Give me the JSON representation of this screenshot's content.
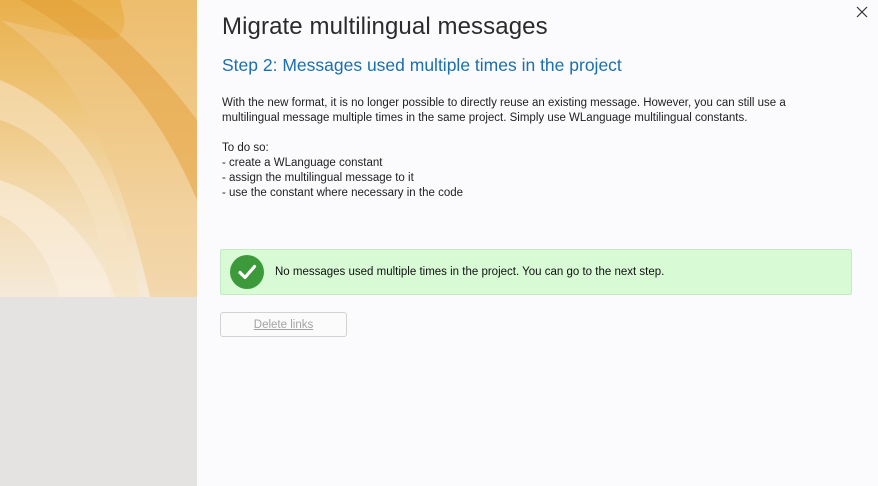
{
  "window": {
    "title": "Migrate multilingual messages",
    "close_icon": "close-icon"
  },
  "step": {
    "heading": "Step 2: Messages used multiple times in the project"
  },
  "description": {
    "paragraph": "With the new format, it is no longer possible to directly reuse an existing message. However, you can still use a multilingual message multiple times in the same project. Simply use WLanguage multilingual constants.",
    "todo_intro": "To do so:",
    "todo_items": [
      "- create a WLanguage constant",
      "- assign the multilingual message to it",
      "- use the constant where necessary in the code"
    ]
  },
  "status": {
    "icon": "check-circle-icon",
    "message": "No messages used multiple times in the project. You can go to the next step.",
    "color": "#3d9a3a",
    "background": "#d8fbd6"
  },
  "actions": {
    "delete_links_label": "Delete links",
    "delete_links_enabled": false
  },
  "colors": {
    "heading_blue": "#1a6fb0",
    "side_panel_gradient": [
      "#e9b04b",
      "#f5ead8"
    ]
  }
}
